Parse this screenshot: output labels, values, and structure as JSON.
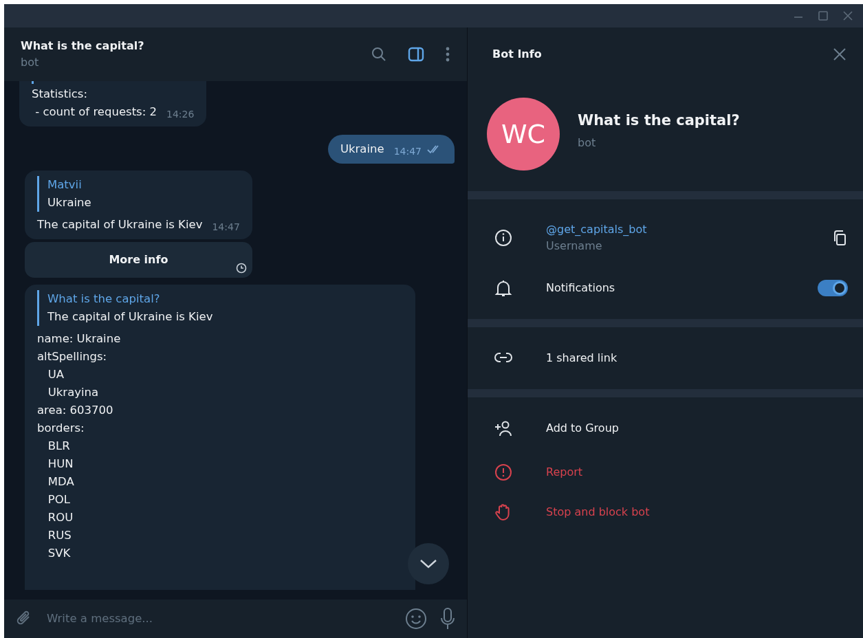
{
  "chat": {
    "title": "What is the capital?",
    "subtitle": "bot",
    "panel_open": true,
    "messages": [
      {
        "kind": "incoming",
        "lines": [
          "Statistics:",
          " - count of requests: 2"
        ],
        "time": "14:26"
      },
      {
        "kind": "outgoing",
        "lines": [
          "Ukraine"
        ],
        "time": "14:47",
        "read": true
      },
      {
        "kind": "incoming",
        "reply": {
          "author": "Matvii",
          "text": "Ukraine"
        },
        "lines": [
          "The capital of Ukraine is Kiev"
        ],
        "time": "14:47",
        "buttons": [
          {
            "label": "More info",
            "pending": true
          }
        ]
      },
      {
        "kind": "incoming",
        "reply": {
          "author": "What is the capital?",
          "text": "The capital of Ukraine is Kiev"
        },
        "lines": [
          "name: Ukraine",
          "altSpellings:",
          "   UA",
          "   Ukrayina",
          "area: 603700",
          "borders:",
          "   BLR",
          "   HUN",
          "   MDA",
          "   POL",
          "   ROU",
          "   RUS",
          "   SVK"
        ]
      }
    ],
    "composer": {
      "placeholder": "Write a message..."
    }
  },
  "info_panel": {
    "title": "Bot Info",
    "profile": {
      "initials": "WC",
      "color": "#e8637f",
      "name": "What is the capital?",
      "subtitle": "bot"
    },
    "sections": [
      {
        "rows": [
          {
            "kind": "username",
            "value": "@get_capitals_bot",
            "label": "Username"
          },
          {
            "kind": "notifications",
            "label": "Notifications",
            "on": true
          }
        ]
      },
      {
        "rows": [
          {
            "kind": "links",
            "label": "1 shared link"
          }
        ]
      },
      {
        "rows": [
          {
            "kind": "add",
            "label": "Add to Group",
            "danger": false
          },
          {
            "kind": "report",
            "label": "Report",
            "danger": true
          },
          {
            "kind": "block",
            "label": "Stop and block bot",
            "danger": true
          }
        ]
      }
    ]
  }
}
